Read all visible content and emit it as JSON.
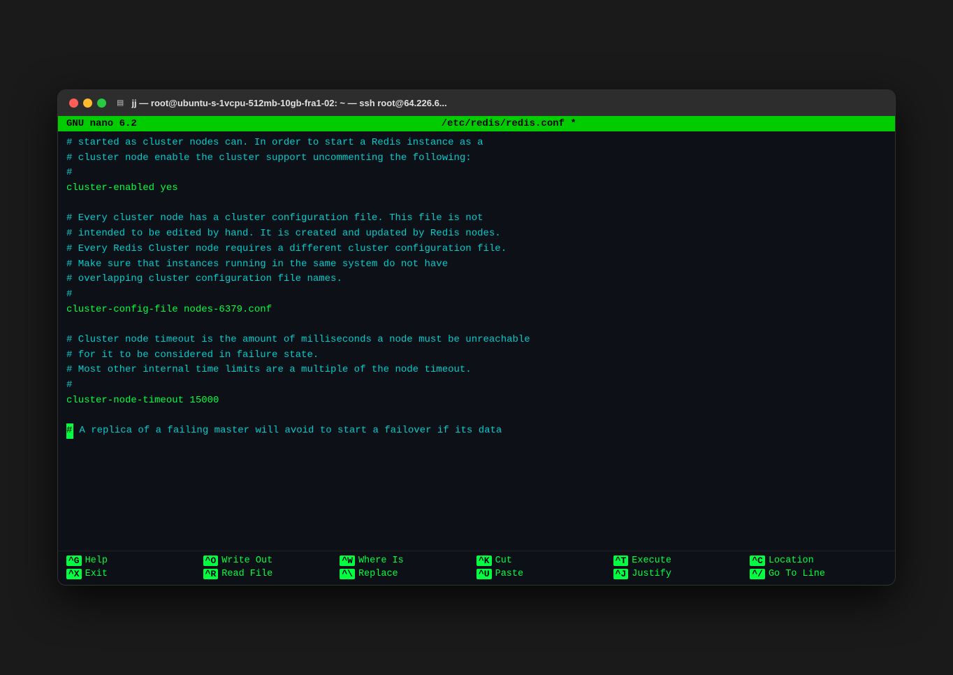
{
  "window": {
    "title": "jj — root@ubuntu-s-1vcpu-512mb-10gb-fra1-02: ~ — ssh root@64.226.6..."
  },
  "nano": {
    "version": "GNU nano 6.2",
    "filename": "/etc/redis/redis.conf *"
  },
  "content": {
    "lines": [
      {
        "type": "comment",
        "text": "# started as cluster nodes can. In order to start a Redis instance as a"
      },
      {
        "type": "comment",
        "text": "# cluster node enable the cluster support uncommenting the following:"
      },
      {
        "type": "comment",
        "text": "#"
      },
      {
        "type": "config",
        "text": "cluster-enabled yes"
      },
      {
        "type": "empty"
      },
      {
        "type": "comment",
        "text": "# Every cluster node has a cluster configuration file. This file is not"
      },
      {
        "type": "comment",
        "text": "# intended to be edited by hand. It is created and updated by Redis nodes."
      },
      {
        "type": "comment",
        "text": "# Every Redis Cluster node requires a different cluster configuration file."
      },
      {
        "type": "comment",
        "text": "# Make sure that instances running in the same system do not have"
      },
      {
        "type": "comment",
        "text": "# overlapping cluster configuration file names."
      },
      {
        "type": "comment",
        "text": "#"
      },
      {
        "type": "config",
        "text": "cluster-config-file nodes-6379.conf"
      },
      {
        "type": "empty"
      },
      {
        "type": "comment",
        "text": "# Cluster node timeout is the amount of milliseconds a node must be unreachable"
      },
      {
        "type": "comment",
        "text": "# for it to be considered in failure state."
      },
      {
        "type": "comment",
        "text": "# Most other internal time limits are a multiple of the node timeout."
      },
      {
        "type": "comment",
        "text": "#"
      },
      {
        "type": "config",
        "text": "cluster-node-timeout 15000"
      },
      {
        "type": "empty"
      },
      {
        "type": "cursor",
        "text": "# A replica of a failing master will avoid to start a failover if its data"
      }
    ]
  },
  "footer": {
    "items": [
      {
        "key": "^G",
        "label": "Help"
      },
      {
        "key": "^O",
        "label": "Write Out"
      },
      {
        "key": "^W",
        "label": "Where Is"
      },
      {
        "key": "^K",
        "label": "Cut"
      },
      {
        "key": "^T",
        "label": "Execute"
      },
      {
        "key": "^C",
        "label": "Location"
      },
      {
        "key": "^X",
        "label": "Exit"
      },
      {
        "key": "^R",
        "label": "Read File"
      },
      {
        "key": "^\\",
        "label": "Replace"
      },
      {
        "key": "^U",
        "label": "Paste"
      },
      {
        "key": "^J",
        "label": "Justify"
      },
      {
        "key": "^/",
        "label": "Go To Line"
      }
    ]
  }
}
